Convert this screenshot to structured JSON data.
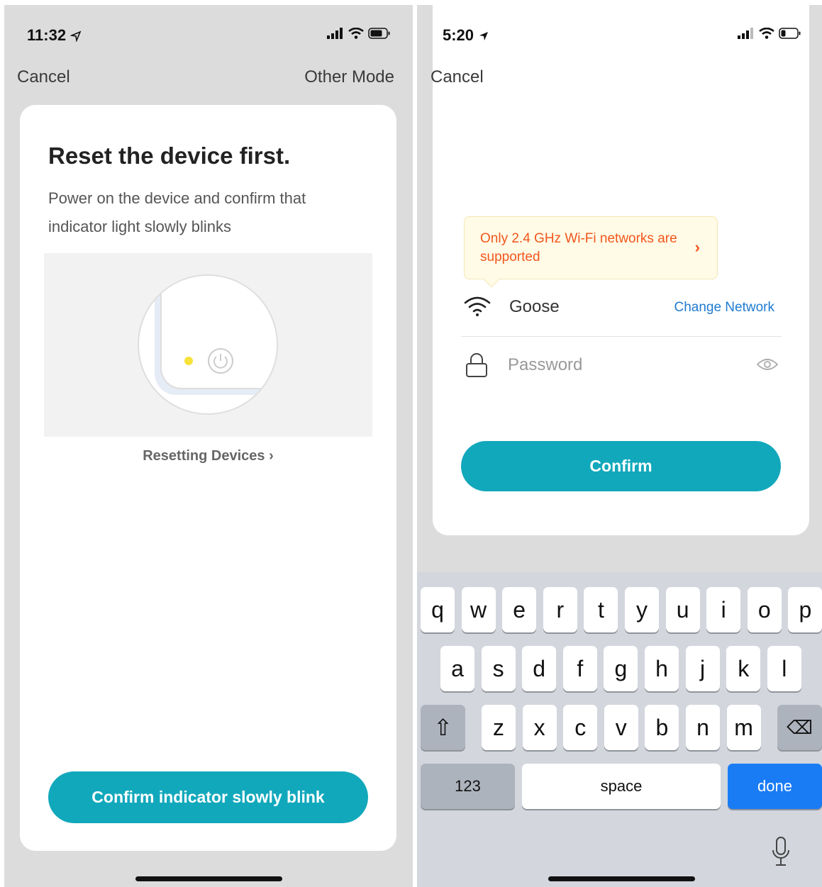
{
  "left_screen": {
    "status": {
      "time": "11:32"
    },
    "nav": {
      "cancel": "Cancel",
      "other_mode": "Other Mode"
    },
    "card": {
      "title": "Reset the device first.",
      "description": "Power on the device and confirm that indicator light slowly blinks",
      "link": "Resetting Devices ›",
      "button": "Confirm indicator slowly blink"
    },
    "colors": {
      "accent": "#12a8bc",
      "indicator": "#f7e23a"
    }
  },
  "right_screen": {
    "status": {
      "time": "5:20"
    },
    "nav": {
      "cancel": "Cancel"
    },
    "tip": {
      "text": "Only 2.4 GHz Wi-Fi networks are supported",
      "chevron": "›",
      "color": "#f2561d"
    },
    "network": {
      "name": "Goose",
      "change_label": "Change Network"
    },
    "password": {
      "placeholder": "Password",
      "value": ""
    },
    "button": "Confirm",
    "keyboard": {
      "row1": [
        "q",
        "w",
        "e",
        "r",
        "t",
        "y",
        "u",
        "i",
        "o",
        "p"
      ],
      "row2": [
        "a",
        "s",
        "d",
        "f",
        "g",
        "h",
        "j",
        "k",
        "l"
      ],
      "row3": [
        "z",
        "x",
        "c",
        "v",
        "b",
        "n",
        "m"
      ],
      "shift": "⇧",
      "backspace": "⌫",
      "numbers": "123",
      "space": "space",
      "done": "done"
    },
    "colors": {
      "accent": "#12a8bc",
      "link": "#1e7bd0",
      "done_key": "#1a7cf5"
    }
  }
}
